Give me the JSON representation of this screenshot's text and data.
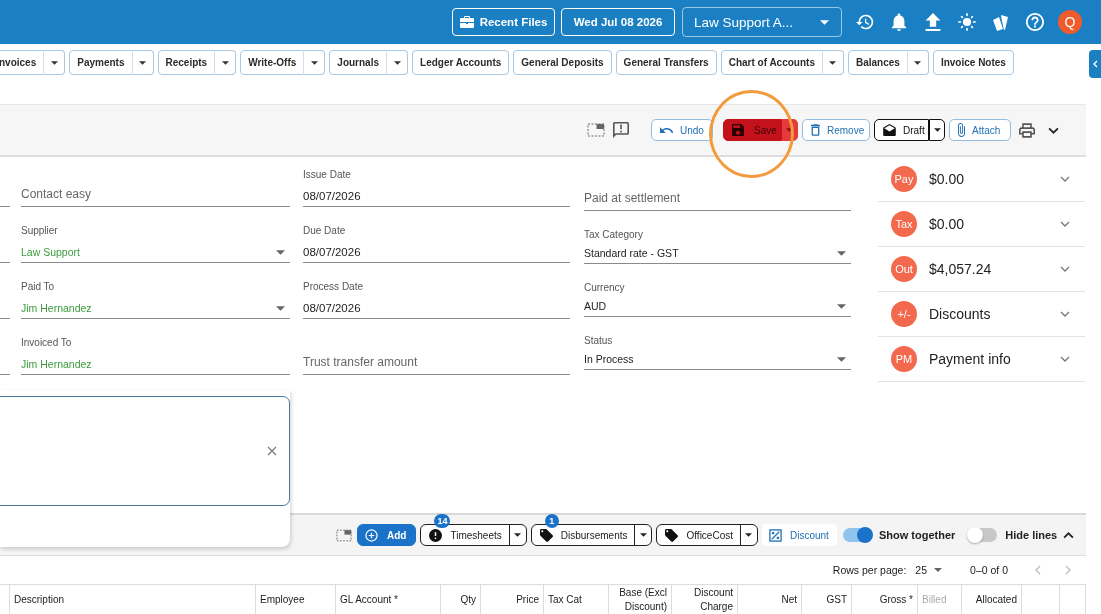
{
  "top_bar": {
    "buttons": [
      {
        "kind": "recent",
        "label": "Recent Files"
      },
      {
        "kind": "date",
        "label": "Wed Jul 08 2026"
      }
    ],
    "workspace": {
      "value": "Law Support A..."
    },
    "user": {
      "initial": "Q"
    }
  },
  "nav": [
    {
      "label": "nvoices",
      "split": true
    },
    {
      "label": "Payments",
      "split": true
    },
    {
      "label": "Receipts",
      "split": true
    },
    {
      "label": "Write-Offs",
      "split": true
    },
    {
      "label": "Journals",
      "split": true
    },
    {
      "label": "Ledger Accounts",
      "split": false
    },
    {
      "label": "General Deposits",
      "split": false
    },
    {
      "label": "General Transfers",
      "split": false
    },
    {
      "label": "Chart of Accounts",
      "split": true
    },
    {
      "label": "Balances",
      "split": true
    },
    {
      "label": "Invoice Notes",
      "split": false
    }
  ],
  "toolbar": {
    "buttons": [
      {
        "kind": "undo",
        "label": "Undo",
        "split": false,
        "highlighted": false
      },
      {
        "kind": "save",
        "label": "Save",
        "split": true,
        "highlighted": true
      },
      {
        "kind": "remove",
        "label": "Remove",
        "split": false,
        "highlighted": false
      },
      {
        "kind": "draft",
        "label": "Draft",
        "split": true,
        "highlighted": false
      },
      {
        "kind": "attach",
        "label": "Attach",
        "split": false,
        "highlighted": false
      }
    ]
  },
  "form": {
    "columns": [
      {
        "fields": [
          {
            "kind": "input",
            "placeholder": "Contact easy",
            "linked": false
          },
          {
            "kind": "select",
            "label": "Supplier",
            "value": "Law Support",
            "linked": true
          },
          {
            "kind": "select",
            "label": "Paid To",
            "value": "Jim Hernandez",
            "linked": true
          },
          {
            "kind": "input",
            "label": "Invoiced To",
            "value": "Jim Hernandez",
            "linked": true
          }
        ]
      },
      {
        "fields": [
          {
            "kind": "input",
            "label": "Issue Date",
            "value": "08/07/2026",
            "linked": false
          },
          {
            "kind": "input",
            "label": "Due Date",
            "value": "08/07/2026",
            "linked": false
          },
          {
            "kind": "input",
            "label": "Process Date",
            "value": "08/07/2026",
            "linked": false
          },
          {
            "kind": "input",
            "placeholder": "Trust transfer amount",
            "linked": false
          }
        ]
      },
      {
        "fields": [
          {
            "kind": "input",
            "placeholder": "Paid at settlement",
            "linked": false
          },
          {
            "kind": "select",
            "label": "Tax Category",
            "value": "Standard rate - GST",
            "linked": false
          },
          {
            "kind": "select",
            "label": "Currency",
            "value": "AUD",
            "linked": false
          },
          {
            "kind": "select",
            "label": "Status",
            "value": "In Process",
            "linked": false
          }
        ]
      }
    ]
  },
  "summary": [
    {
      "badge": "Pay",
      "text": "$0.00"
    },
    {
      "badge": "Tax",
      "text": "$0.00"
    },
    {
      "badge": "Out",
      "text": "$4,057.24"
    },
    {
      "badge": "+/-",
      "text": "Discounts"
    },
    {
      "badge": "PM",
      "text": "Payment info"
    }
  ],
  "lines_toolbar": {
    "buttons": [
      {
        "kind": "add",
        "label": "Add",
        "split": false
      },
      {
        "kind": "timer",
        "label": "Timesheets",
        "split": true,
        "count": "14"
      },
      {
        "kind": "tag",
        "label": "Disbursements",
        "split": true,
        "count": "1"
      },
      {
        "kind": "tag",
        "label": "OfficeCost",
        "split": true
      },
      {
        "kind": "percent",
        "label": "Discount",
        "split": false
      }
    ],
    "toggles": [
      {
        "label": "Show together",
        "on": true
      },
      {
        "label": "Hide lines",
        "on": false
      }
    ]
  },
  "pagination": {
    "rows_label": "Rows per page:",
    "rows_per_page": "25",
    "range": "0–0 of 0",
    "prev_disabled": true,
    "next_disabled": true
  },
  "table": {
    "columns": [
      {
        "label": "Description",
        "kind": "text",
        "disabled": false
      },
      {
        "label": "Employee",
        "kind": "text",
        "disabled": false
      },
      {
        "label": "GL Account *",
        "kind": "text",
        "disabled": false
      },
      {
        "label": "Qty",
        "kind": "number",
        "disabled": false
      },
      {
        "label": "Price",
        "kind": "number",
        "disabled": false
      },
      {
        "label": "Tax Cat",
        "kind": "text",
        "disabled": false
      },
      {
        "label": "Base (Excl Discount)",
        "kind": "number",
        "disabled": false
      },
      {
        "label": "Discount Charge",
        "kind": "number",
        "disabled": false
      },
      {
        "label": "Net",
        "kind": "number",
        "disabled": false
      },
      {
        "label": "GST",
        "kind": "number",
        "disabled": false
      },
      {
        "label": "Gross *",
        "kind": "number",
        "disabled": false
      },
      {
        "label": "Billed",
        "kind": "text",
        "disabled": true
      },
      {
        "label": "Allocated",
        "kind": "number",
        "disabled": false
      }
    ]
  }
}
